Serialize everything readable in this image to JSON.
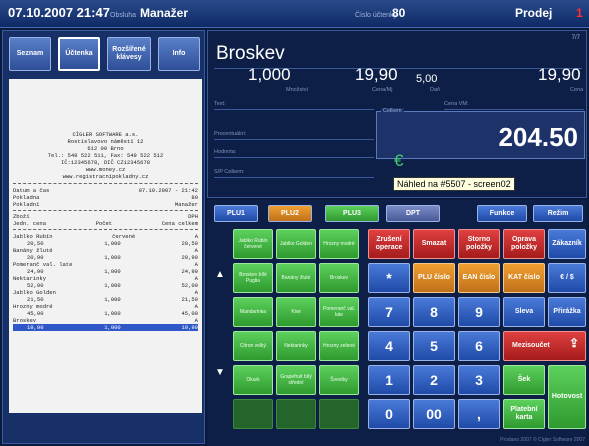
{
  "topbar": {
    "datetime": "07.10.2007 21:47",
    "operator_label": "Obsluha",
    "operator": "Manažer",
    "receipt_no_label": "Číslo účtenky",
    "receipt_no": "80",
    "mode": "Prodej",
    "counter": "1"
  },
  "nav": {
    "seznam": "Seznam",
    "uctenka": "Účtenka",
    "rozsirene": "Rozšířené klávesy",
    "info": "Info"
  },
  "receipt": {
    "header": [
      "CÍGLER SOFTWARE a.s.",
      "Rostislavovo náměstí 12",
      "612 00 Brno",
      "Tel.: 549 522 511, Fax: 549 522 512",
      "IČ:12345678, DIČ CZ12345678",
      "www.money.cz",
      "www.registracnipokladny.cz"
    ],
    "info": [
      {
        "l": "Datum a čas",
        "r": "07.10.2007 - 21:42"
      },
      {
        "l": "Pokladna",
        "r": "80"
      },
      {
        "l": "Pokladní",
        "r": "Manažer"
      }
    ],
    "col_head1": {
      "l": "Zboží",
      "r": "DPH"
    },
    "col_head2": {
      "l": "Jedn. cena",
      "m": "Počet",
      "r": "Cena celkem"
    },
    "items": [
      {
        "name": "Jablko Rubín",
        "extra": "červené",
        "vat": "A",
        "price": "20,50",
        "qty": "1,000",
        "total": "20,50"
      },
      {
        "name": "Banány žluté",
        "extra": "",
        "vat": "A",
        "price": "20,90",
        "qty": "1,000",
        "total": "20,90"
      },
      {
        "name": "Pomeranč val. late",
        "extra": "",
        "vat": "A",
        "price": "24,90",
        "qty": "1,000",
        "total": "24,90"
      },
      {
        "name": "Nektarinky",
        "extra": "",
        "vat": "A",
        "price": "52,00",
        "qty": "1,000",
        "total": "52,00"
      },
      {
        "name": "Jablko Golden",
        "extra": "",
        "vat": "A",
        "price": "21,50",
        "qty": "1,000",
        "total": "21,50"
      },
      {
        "name": "Hrozny modré",
        "extra": "",
        "vat": "A",
        "price": "45,00",
        "qty": "1,000",
        "total": "45,00"
      },
      {
        "name": "Broskev",
        "extra": "",
        "vat": "A",
        "price": "19,90",
        "qty": "1,000",
        "total": "19,90"
      }
    ]
  },
  "display": {
    "page": "7/7",
    "item_name": "Broskev",
    "qty": "1,000",
    "qty_label": "Množství",
    "unit_price": "19,90",
    "unit_price_label": "Cena/Mj",
    "vat": "5,00",
    "vat_label": "Daň",
    "price": "19,90",
    "price_label": "Cena",
    "text_label": "Text:",
    "price_vm_label": "Cena VM:",
    "percent_label": "Procentuální:",
    "value_label": "Hodnota:",
    "sp_label": "S/P Celkem:",
    "total_label": "Celkem",
    "total": "204.50",
    "currency_icon": "€",
    "tooltip": "Náhled na #5507 - screen02"
  },
  "tabs": {
    "plu1": "PLU1",
    "plu2": "PLU2",
    "plu3": "PLU3",
    "dpt": "DPT",
    "funkce": "Funkce",
    "rezim": "Režim"
  },
  "quick_keys": [
    "Jablko Rubín červené",
    "Jablko Golden",
    "Hrozny modré",
    "Broskev bílé Puglia",
    "Banány žluté",
    "Broskev",
    "Mandarinka",
    "Kiwi",
    "Pomeranč val. late",
    "Citron velký",
    "Nektarinky",
    "Hrozny zelené",
    "Okurk",
    "Grapefruit bílý střední",
    "Švestky"
  ],
  "keys": {
    "zruseni": "Zrušení operace",
    "smazat": "Smazat",
    "storno": "Storno položky",
    "oprava": "Oprava položky",
    "zakaznik": "Zákazník",
    "star": "*",
    "plu_cislo": "PLU číslo",
    "ean_cislo": "EAN číslo",
    "kat_cislo": "KAT číslo",
    "kc_euro": "€ / $",
    "n7": "7",
    "n8": "8",
    "n9": "9",
    "sleva": "Sleva",
    "prirazka": "Přirážka",
    "n4": "4",
    "n5": "5",
    "n6": "6",
    "mezisoucet": "Mezisoučet",
    "n1": "1",
    "n2": "2",
    "n3": "3",
    "sek": "Šek",
    "hotovost": "Hotovost",
    "n0": "0",
    "n00": "00",
    "comma": ",",
    "platebni_karta": "Platební karta"
  },
  "footer": "Prodano 2007 © Cígler Software 2007"
}
